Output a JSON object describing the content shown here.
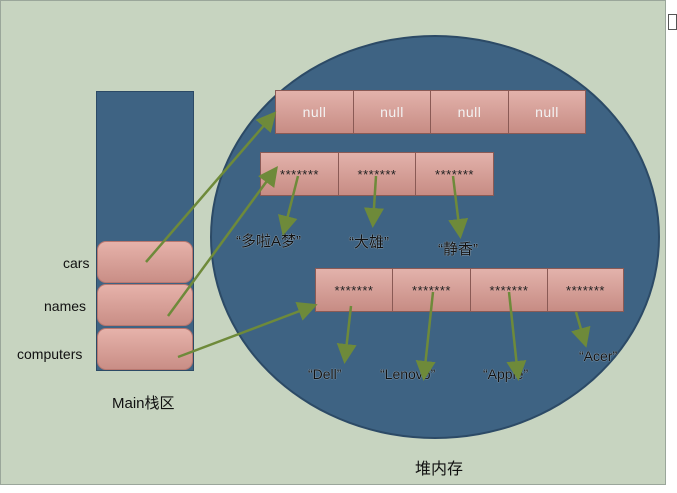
{
  "stack": {
    "title": "Main栈区",
    "vars": [
      "cars",
      "names",
      "computers"
    ]
  },
  "heap": {
    "title": "堆内存",
    "cars_array": [
      "null",
      "null",
      "null",
      "null"
    ],
    "names_array": [
      "*******",
      "*******",
      "*******"
    ],
    "names_values": [
      "“多啦A梦”",
      "“大雄”",
      "“静香”"
    ],
    "computers_array": [
      "*******",
      "*******",
      "*******",
      "*******"
    ],
    "computers_values": [
      "“Dell”",
      "“Lenovo”",
      "“Apple”",
      "“Acer”"
    ]
  },
  "colors": {
    "background": "#c7d4c0",
    "heap": "#3e6383",
    "cell": "#d9a39b",
    "arrow": "#6e8a3a"
  }
}
